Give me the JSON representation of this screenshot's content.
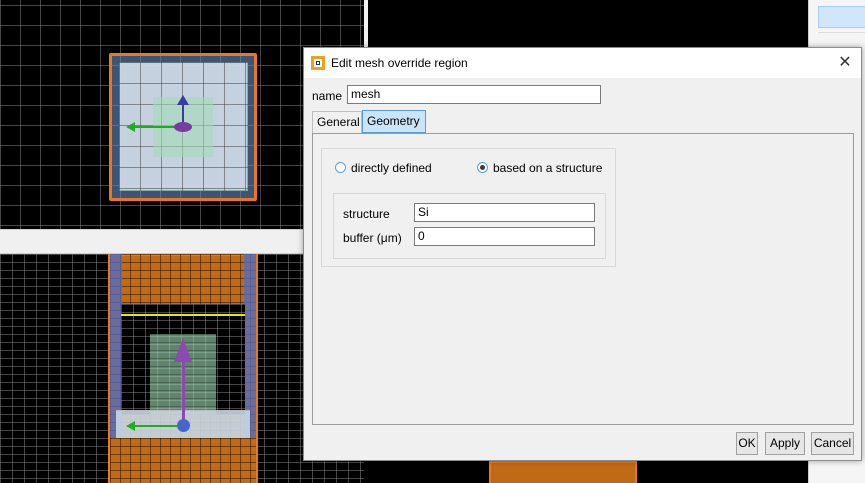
{
  "dialog": {
    "title": "Edit mesh override region",
    "close_glyph": "✕",
    "name_label": "name",
    "name_value": "mesh",
    "tabs": [
      {
        "label": "General",
        "active": false
      },
      {
        "label": "Geometry",
        "active": true
      }
    ],
    "geometry": {
      "radio_directly_defined": "directly defined",
      "radio_based_on_structure": "based on a structure",
      "selected": "based on a structure",
      "structure_label": "structure",
      "structure_value": "Si",
      "buffer_label": "buffer (μm)",
      "buffer_value": "0"
    },
    "buttons": {
      "ok": "OK",
      "apply": "Apply",
      "cancel": "Cancel"
    }
  },
  "colors": {
    "viewport_background": "#000000",
    "override_region_outline": "#e87a1c",
    "structure_fill": "#c8d4e0",
    "axis_x_arrow": "#22aa22",
    "axis_y_arrow": "#7a3aa0",
    "axis_z_arrow": "#3a3aa0",
    "monitor_line": "#e8e800",
    "selected_tab": "#cce4f7"
  }
}
